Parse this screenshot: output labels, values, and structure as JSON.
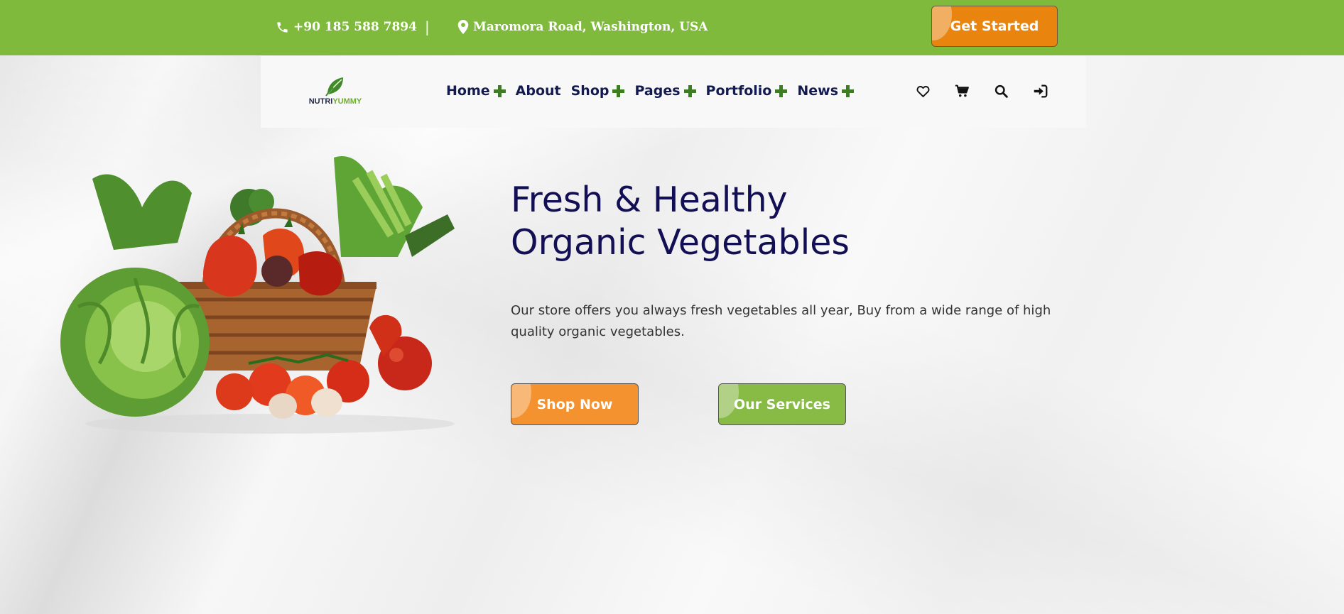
{
  "topbar": {
    "phone": "+90 185 588 7894",
    "divider": "|",
    "address": "Maromora Road, Washington, USA",
    "cta_label": "Get Started",
    "bg_color": "#7fba3c",
    "cta_color": "#e9850f"
  },
  "nav": {
    "logo_part1": "NUTRI",
    "logo_part2": "YUMMY",
    "items": [
      {
        "label": "Home",
        "has_submenu": true
      },
      {
        "label": "About",
        "has_submenu": false
      },
      {
        "label": "Shop",
        "has_submenu": true
      },
      {
        "label": "Pages",
        "has_submenu": true
      },
      {
        "label": "Portfolio",
        "has_submenu": true
      },
      {
        "label": "News",
        "has_submenu": true
      }
    ],
    "icons": [
      "heart-icon",
      "cart-icon",
      "search-icon",
      "login-icon"
    ]
  },
  "hero": {
    "title_line1": "Fresh & Healthy",
    "title_line2": "Organic Vegetables",
    "description": "Our store offers you always fresh vegetables all year, Buy from a wide range of high quality organic vegetables.",
    "primary_button": "Shop Now",
    "secondary_button": "Our Services",
    "title_color": "#130f55",
    "primary_color": "#f4922f",
    "secondary_color": "#88bb45"
  }
}
